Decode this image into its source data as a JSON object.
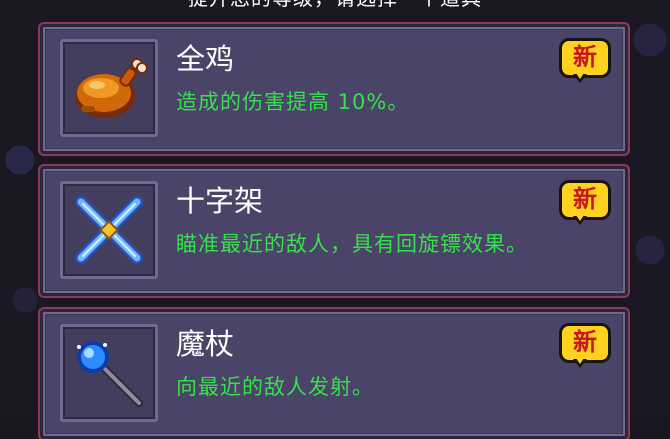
{
  "header": {
    "text": "提升您的等级，请选择一个道具"
  },
  "cards": [
    {
      "title": "全鸡",
      "description": "造成的伤害提高 10%。",
      "badge": "新",
      "icon": "roast-chicken-icon"
    },
    {
      "title": "十字架",
      "description": "瞄准最近的敌人，具有回旋镖效果。",
      "badge": "新",
      "icon": "cross-boomerang-icon"
    },
    {
      "title": "魔杖",
      "description": "向最近的敌人发射。",
      "badge": "新",
      "icon": "magic-wand-icon"
    }
  ],
  "colors": {
    "description_text": "#36e04a",
    "title_text": "#ffffff",
    "badge_bg": "#ffd21f",
    "badge_text": "#c8161a",
    "card_bg": "#4a4469",
    "card_outline": "#8a3b55"
  }
}
